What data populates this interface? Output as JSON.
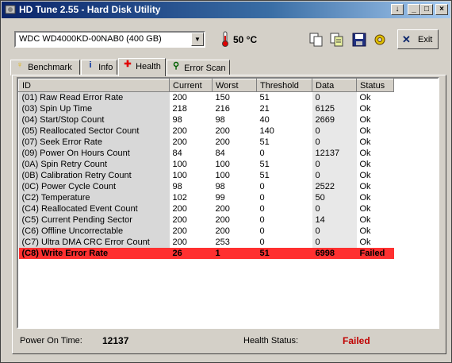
{
  "window": {
    "title": "HD Tune 2.55 - Hard Disk Utility",
    "buttons": [
      "↓",
      "_",
      "□",
      "×"
    ]
  },
  "toolbar": {
    "drive": "WDC WD4000KD-00NAB0 (400 GB)",
    "temperature": "50 °C",
    "exit_label": "Exit",
    "icons": [
      "copy-info-icon",
      "copy-all-icon",
      "save-icon",
      "options-icon"
    ]
  },
  "tabs": [
    {
      "label": "Benchmark",
      "icon": "bulb-icon"
    },
    {
      "label": "Info",
      "icon": "info-icon"
    },
    {
      "label": "Health",
      "icon": "health-cross-icon",
      "active": true
    },
    {
      "label": "Error Scan",
      "icon": "magnifier-icon"
    }
  ],
  "table": {
    "headers": [
      "ID",
      "Current",
      "Worst",
      "Threshold",
      "Data",
      "Status"
    ],
    "rows": [
      [
        "(01) Raw Read Error Rate",
        "200",
        "150",
        "51",
        "0",
        "Ok"
      ],
      [
        "(03) Spin Up Time",
        "218",
        "216",
        "21",
        "6125",
        "Ok"
      ],
      [
        "(04) Start/Stop Count",
        "98",
        "98",
        "40",
        "2669",
        "Ok"
      ],
      [
        "(05) Reallocated Sector Count",
        "200",
        "200",
        "140",
        "0",
        "Ok"
      ],
      [
        "(07) Seek Error Rate",
        "200",
        "200",
        "51",
        "0",
        "Ok"
      ],
      [
        "(09) Power On Hours Count",
        "84",
        "84",
        "0",
        "12137",
        "Ok"
      ],
      [
        "(0A) Spin Retry Count",
        "100",
        "100",
        "51",
        "0",
        "Ok"
      ],
      [
        "(0B) Calibration Retry Count",
        "100",
        "100",
        "51",
        "0",
        "Ok"
      ],
      [
        "(0C) Power Cycle Count",
        "98",
        "98",
        "0",
        "2522",
        "Ok"
      ],
      [
        "(C2) Temperature",
        "102",
        "99",
        "0",
        "50",
        "Ok"
      ],
      [
        "(C4) Reallocated Event Count",
        "200",
        "200",
        "0",
        "0",
        "Ok"
      ],
      [
        "(C5) Current Pending Sector",
        "200",
        "200",
        "0",
        "14",
        "Ok"
      ],
      [
        "(C6) Offline Uncorrectable",
        "200",
        "200",
        "0",
        "0",
        "Ok"
      ],
      [
        "(C7) Ultra DMA CRC Error Count",
        "200",
        "253",
        "0",
        "0",
        "Ok"
      ],
      [
        "(C8) Write Error Rate",
        "26",
        "1",
        "51",
        "6998",
        "Failed"
      ]
    ]
  },
  "footer": {
    "power_on_label": "Power On Time:",
    "power_on_value": "12137",
    "health_label": "Health Status:",
    "health_value": "Failed"
  },
  "colors": {
    "failed_row": "#ff3030",
    "failed_text": "#c00000",
    "title_gradient_start": "#0a246a"
  }
}
